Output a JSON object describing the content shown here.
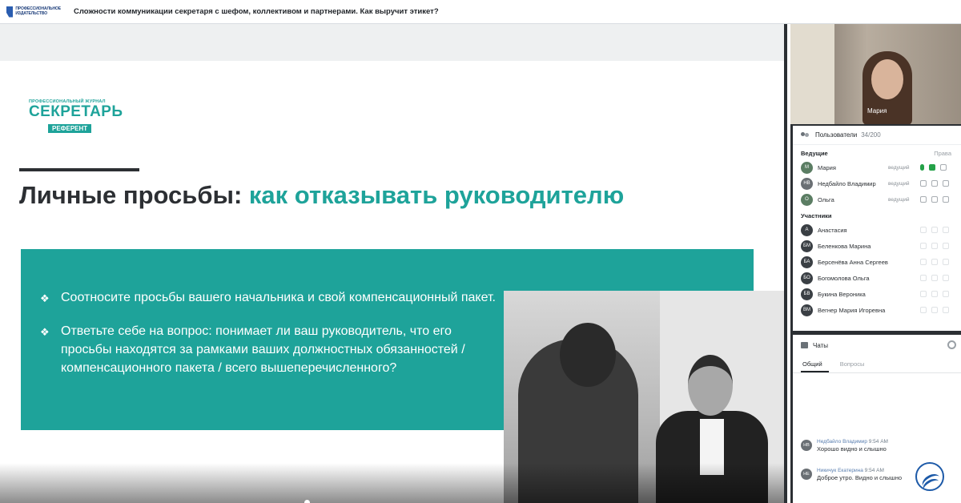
{
  "topbar": {
    "brand_line1": "ПРОФЕССИОНАЛЬНОЕ",
    "brand_line2": "ИЗДАТЕЛЬСТВО",
    "meeting_title": "Сложности коммуникации секретаря с шефом, коллективом и партнерами. Как выручит этикет?"
  },
  "slide": {
    "logo_small": "ПРОФЕССИОНАЛЬНЫЙ ЖУРНАЛ",
    "logo_big": "СЕКРЕТАРЬ",
    "logo_sub": "РЕФЕРЕНТ",
    "title_main": "Личные просьбы: ",
    "title_accent": "как отказывать руководителю",
    "bullets": [
      "Соотносите просьбы вашего начальника и свой компенсационный пакет.",
      "Ответьте себе на вопрос: понимает ли ваш руководитель, что его просьбы находятся за рамками ваших должностных обязанностей / компенсационного пакета / всего вышеперечисленного?"
    ],
    "colors": {
      "accent": "#1ea39a",
      "title": "#2c2f33"
    }
  },
  "video": {
    "name": "Мария"
  },
  "users": {
    "header_label": "Пользователи",
    "count": "34/200",
    "hosts_label": "Ведущие",
    "rights_label": "Права",
    "participants_label": "Участники",
    "hosts": [
      {
        "initials": "М",
        "name": "Мария",
        "role": "ведущий"
      },
      {
        "initials": "НВ",
        "name": "Недбайло Владимир",
        "role": "ведущий"
      },
      {
        "initials": "О",
        "name": "Ольга",
        "role": "ведущий"
      }
    ],
    "participants": [
      {
        "initials": "А",
        "name": "Анастасия"
      },
      {
        "initials": "БМ",
        "name": "Беленкова Марина"
      },
      {
        "initials": "БА",
        "name": "Берсенёва Анна Сергеевна"
      },
      {
        "initials": "БО",
        "name": "Богомолова Ольга"
      },
      {
        "initials": "БВ",
        "name": "Букина Вероника"
      },
      {
        "initials": "ВМ",
        "name": "Вегнер Мария Игоревна"
      }
    ]
  },
  "chats": {
    "header_label": "Чаты",
    "tabs": [
      "Общий",
      "Вопросы"
    ],
    "messages": [
      {
        "initials": "НВ",
        "who": "Недбайло Владимир",
        "time": "9:54 AM",
        "text": "Хорошо видно и слышно"
      },
      {
        "initials": "НЕ",
        "who": "Никичук Екатерина",
        "time": "9:54 AM",
        "text": "Доброе утро. Видно и слышно"
      }
    ]
  }
}
